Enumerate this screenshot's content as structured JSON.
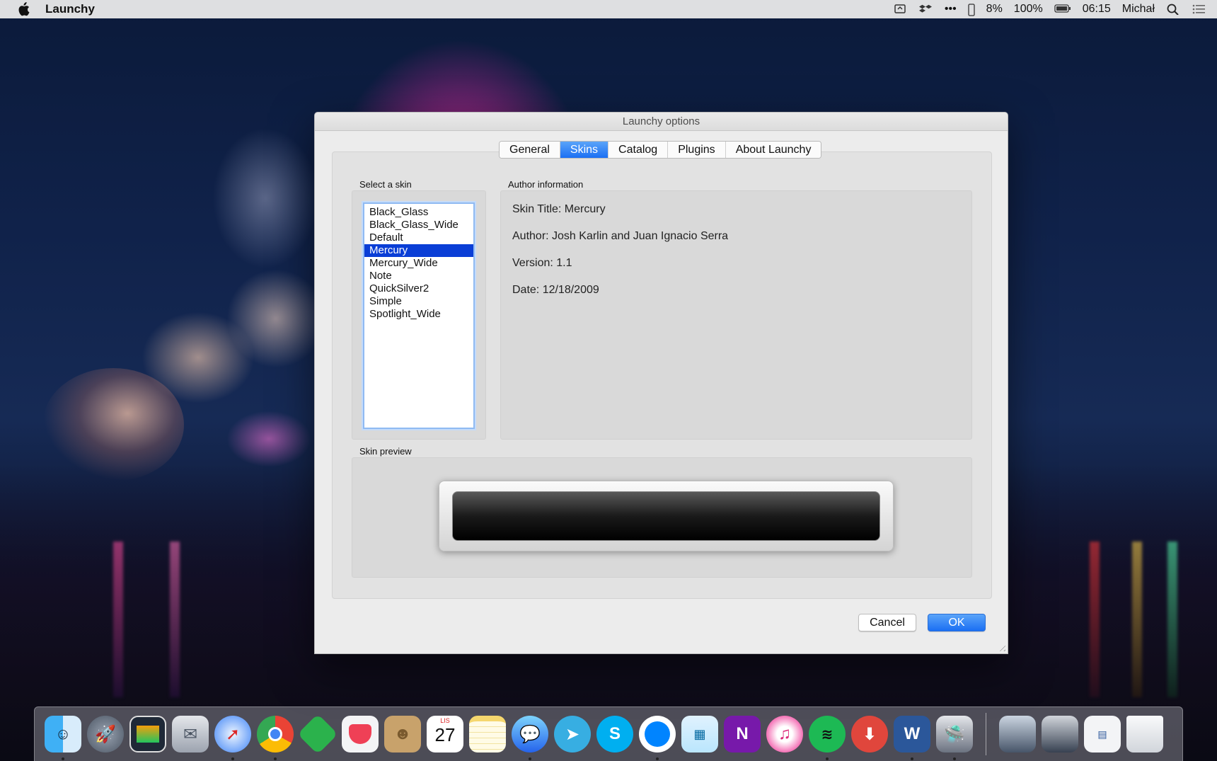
{
  "menubar": {
    "app_name": "Launchy",
    "battery_percent_a": "8%",
    "battery_percent_b": "100%",
    "clock": "06:15",
    "user": "Michał",
    "more_icon": "•••"
  },
  "dialog": {
    "title": "Launchy options",
    "tabs": [
      "General",
      "Skins",
      "Catalog",
      "Plugins",
      "About Launchy"
    ],
    "active_tab": "Skins",
    "select_skin_label": "Select a skin",
    "skins": [
      "Black_Glass",
      "Black_Glass_Wide",
      "Default",
      "Mercury",
      "Mercury_Wide",
      "Note",
      "QuickSilver2",
      "Simple",
      "Spotlight_Wide"
    ],
    "selected_skin": "Mercury",
    "author_info_label": "Author information",
    "author_lines": [
      "Skin Title: Mercury",
      "Author: Josh Karlin and Juan Ignacio Serra",
      "Version: 1.1",
      "Date: 12/18/2009"
    ],
    "skin_preview_label": "Skin preview",
    "cancel_label": "Cancel",
    "ok_label": "OK"
  },
  "dock": {
    "apps": [
      "finder-icon",
      "launchpad-icon",
      "photo-slideshow-icon",
      "mail-icon",
      "safari-icon",
      "chrome-icon",
      "feedly-icon",
      "pocket-icon",
      "contacts-icon",
      "calendar-icon",
      "notes-icon",
      "messages-icon",
      "telegram-icon",
      "skype-icon",
      "messenger-icon",
      "preview-icon",
      "onenote-icon",
      "itunes-icon",
      "spotify-icon",
      "transmit-icon",
      "word-icon",
      "launchy-icon"
    ],
    "calendar_month": "LIS",
    "calendar_day": "27",
    "docs": [
      "stack-downloads-icon",
      "stack-photos-icon",
      "stack-documents-icon",
      "trash-icon"
    ]
  },
  "colors": {
    "accent": "#1b6ff3",
    "selection": "#0a3ed6",
    "dialog_bg": "#ececec"
  }
}
